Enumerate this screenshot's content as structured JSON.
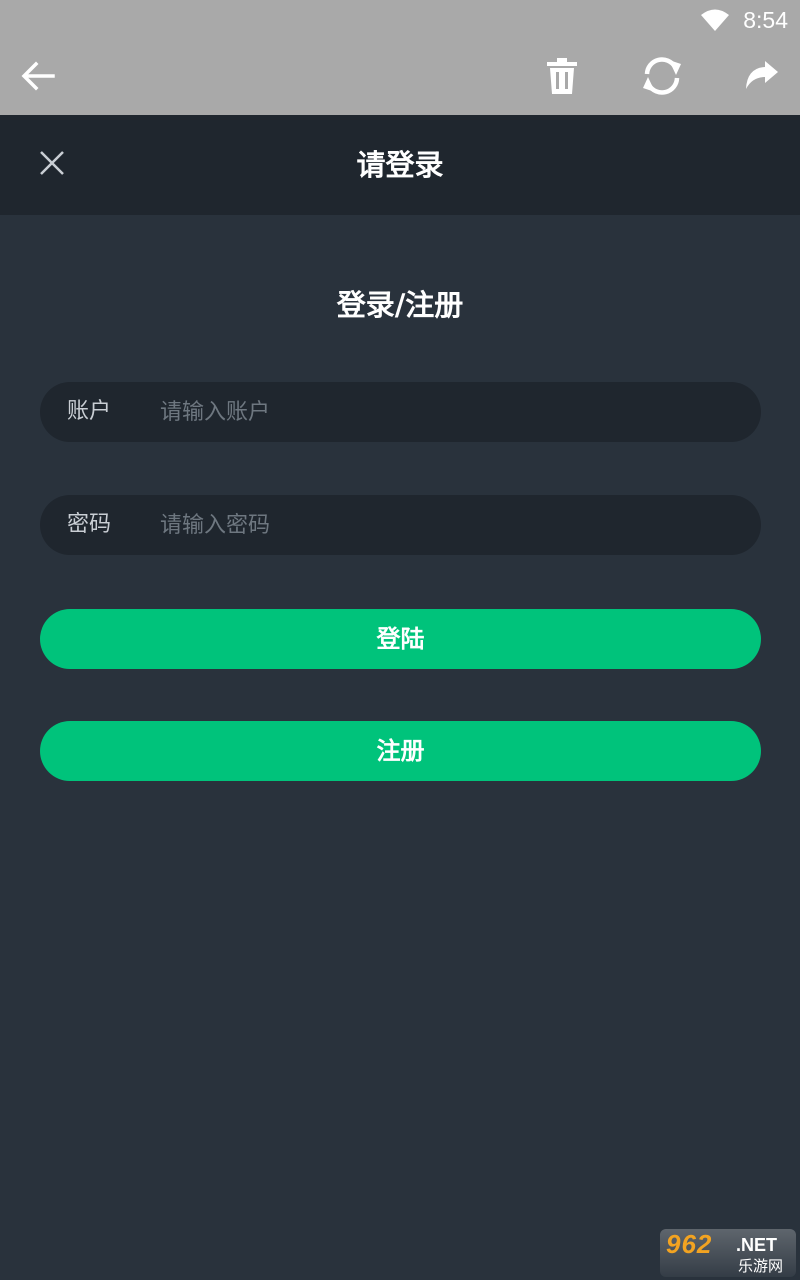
{
  "status_bar": {
    "time": "8:54",
    "icon": "wifi-icon"
  },
  "toolbar": {
    "icons": [
      "back-arrow-icon",
      "trash-icon",
      "refresh-icon",
      "share-icon"
    ]
  },
  "header": {
    "title": "请登录",
    "close_icon": "close-icon"
  },
  "form": {
    "title": "登录/注册",
    "account": {
      "label": "账户",
      "placeholder": "请输入账户",
      "value": ""
    },
    "password": {
      "label": "密码",
      "placeholder": "请输入密码",
      "value": ""
    },
    "login_label": "登陆",
    "register_label": "注册"
  },
  "watermark": {
    "top": "962",
    "net": ".NET",
    "bottom": "乐游网"
  },
  "colors": {
    "background": "#29323c",
    "header_bg": "#1f262e",
    "input_bg": "#1f262e",
    "toolbar_bg": "#a9a9a9",
    "accent_green": "#00c37b",
    "watermark_orange": "#f2a321"
  }
}
